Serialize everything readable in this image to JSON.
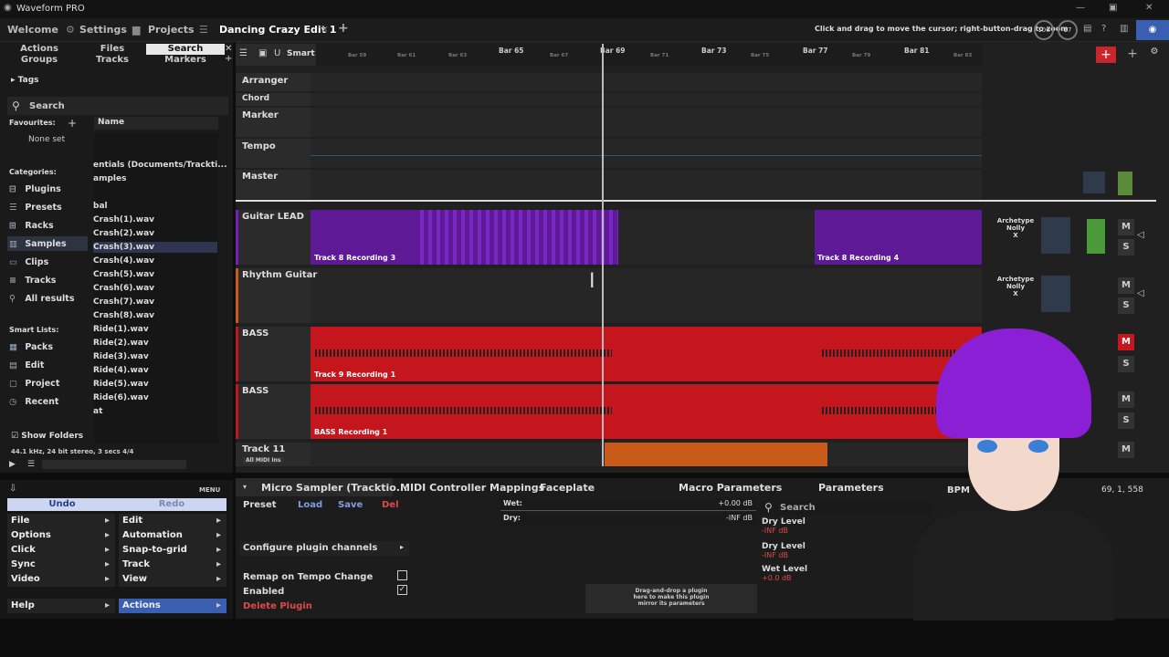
{
  "app": {
    "title": "Waveform PRO",
    "hint": "Click and drag to move the cursor; right-button-drag to zoom",
    "zoom_a": "100",
    "zoom_b": "17"
  },
  "tabs": [
    "Welcome",
    "Settings",
    "Projects",
    "Dancing Crazy Edit 1",
    "+"
  ],
  "browser": {
    "tabs": [
      "Actions",
      "Files",
      "Search",
      "Groups",
      "Tracks",
      "Markers"
    ],
    "tags": "Tags",
    "search_placeholder": "Search",
    "favourites": "Favourites:",
    "none_set": "None set",
    "categories_label": "Categories:",
    "categories": [
      "Plugins",
      "Presets",
      "Racks",
      "Samples",
      "Clips",
      "Tracks",
      "All results"
    ],
    "smart_lists_label": "Smart Lists:",
    "smart_lists": [
      "Packs",
      "Edit",
      "Project",
      "Recent"
    ],
    "show_folders": "Show Folders",
    "file_info": "44.1 kHz, 24 bit stereo, 3 secs  4/4",
    "name_col": "Name",
    "files": [
      "entials (Documents/Trackti...",
      "amples",
      "bal",
      "Crash(1).wav",
      "Crash(2).wav",
      "Crash(3).wav",
      "Crash(4).wav",
      "Crash(5).wav",
      "Crash(6).wav",
      "Crash(7).wav",
      "Crash(8).wav",
      "Ride(1).wav",
      "Ride(2).wav",
      "Ride(3).wav",
      "Ride(4).wav",
      "Ride(5).wav",
      "Ride(6).wav",
      "at"
    ]
  },
  "timeline": {
    "smart": "Smart",
    "bars": [
      "Bar 65",
      "Bar 69",
      "Bar 73",
      "Bar 77",
      "Bar 81"
    ],
    "small_bars": [
      "Bar 59",
      "Bar 61",
      "Bar 63",
      "Bar 67",
      "Bar 71",
      "Bar 75",
      "Bar 79",
      "Bar 83"
    ]
  },
  "tracks": {
    "arranger": "Arranger",
    "chord": "Chord",
    "marker": "Marker",
    "tempo": "Tempo",
    "master": "Master",
    "guitar": "Guitar LEAD",
    "rhythm": "Rhythm Guitar",
    "bass1": "BASS",
    "bass2": "BASS",
    "track11": "Track 11",
    "all_midi": "All MIDI Ins"
  },
  "clips": {
    "g1": "Track 8 Recording 3",
    "g2": "Track 8 Recording 4",
    "b1": "Track 9 Recording 1",
    "b2": "BASS Recording 1"
  },
  "plugin_slot": {
    "name": "Archetype Nolly",
    "x": "X"
  },
  "ms": {
    "m": "M",
    "s": "S"
  },
  "menu": {
    "undo": "Undo",
    "redo": "Redo",
    "label": "MENU",
    "left": [
      "File",
      "Options",
      "Click",
      "Sync",
      "Video"
    ],
    "right": [
      "Edit",
      "Automation",
      "Snap-to-grid",
      "Track",
      "View"
    ],
    "help": "Help",
    "actions": "Actions"
  },
  "plugin": {
    "title": "Micro Sampler (Tracktio...",
    "tabs": [
      "MIDI Controller Mappings",
      "Faceplate",
      "Macro Parameters",
      "Parameters"
    ],
    "preset": "Preset",
    "load": "Load",
    "save": "Save",
    "del": "Del",
    "wet": "Wet:",
    "wet_val": "+0.00 dB",
    "dry": "Dry:",
    "dry_val": "-INF dB",
    "configure": "Configure plugin channels",
    "remap": "Remap on Tempo Change",
    "enabled": "Enabled",
    "delete": "Delete Plugin",
    "drag_text": "Drag-and-drop a plugin here to make this plugin mirror its parameters",
    "search": "Search",
    "params": [
      {
        "name": "Dry Level",
        "val": "-INF dB"
      },
      {
        "name": "Dry Level",
        "val": "-INF dB"
      },
      {
        "name": "Wet Level",
        "val": "+0.0 dB"
      }
    ],
    "bpm": "BPM",
    "position": "69, 1, 558"
  },
  "colors": {
    "purple": "#7a1fb5",
    "red": "#c4161c",
    "orange": "#c85a1a",
    "accent": "#4a6fd6"
  }
}
